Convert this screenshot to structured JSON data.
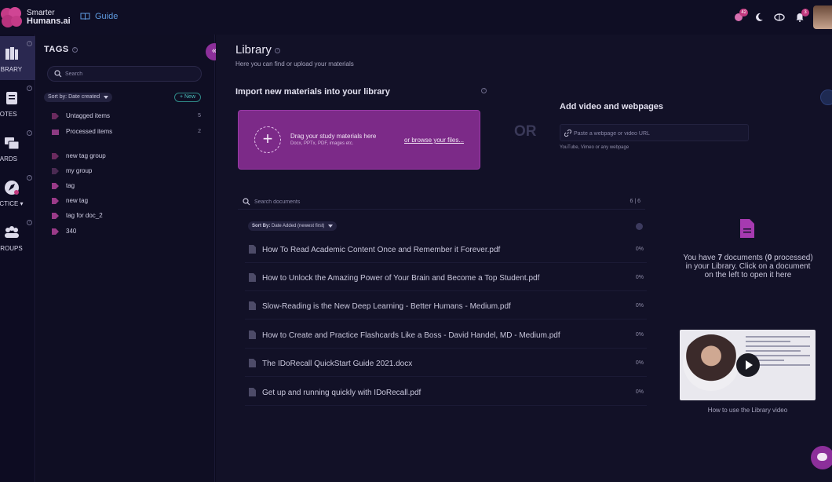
{
  "brand": {
    "line1": "Smarter",
    "line2": "Humans.ai",
    "logo_icon": "brain-logo-icon"
  },
  "header": {
    "guide_label": "Guide",
    "guide_icon": "book-open-icon",
    "icons": [
      {
        "name": "credits-icon",
        "badge": "42"
      },
      {
        "name": "moon-icon",
        "badge": ""
      },
      {
        "name": "brain-icon",
        "badge": ""
      },
      {
        "name": "bell-icon",
        "badge": "3"
      }
    ]
  },
  "rail": [
    {
      "label": "LIBRARY",
      "icon": "library-icon"
    },
    {
      "label": "NOTES",
      "icon": "notes-icon"
    },
    {
      "label": "CARDS",
      "icon": "cards-icon"
    },
    {
      "label": "ACTICE ▾",
      "icon": "rocket-icon"
    },
    {
      "label": "GROUPS",
      "icon": "groups-icon"
    }
  ],
  "tags": {
    "title": "TAGS",
    "search_placeholder": "Search",
    "sort_label": "Sort by: Date created",
    "new_label": "+ New",
    "system": [
      {
        "label": "Untagged items",
        "count": "5"
      },
      {
        "label": "Processed items",
        "count": "2"
      }
    ],
    "items": [
      "new tag group",
      "my group",
      "tag",
      "new tag",
      "tag for doc_2",
      "340"
    ]
  },
  "library": {
    "title": "Library",
    "subtitle": "Here you can find or upload your materials",
    "import_title": "Import new materials into your library",
    "drop_title": "Drag your study materials here",
    "drop_hint": "Docx, PPTx, PDF, images etc.",
    "browse_label": "or browse your files...",
    "or_label": "OR",
    "add_video_title": "Add video and webpages",
    "url_placeholder": "Paste a webpage or video URL",
    "url_hint": "YouTube, Vimeo or any webpage",
    "doc_search_placeholder": "Search documents",
    "doc_count": "6 | 6",
    "sort_prefix": "Sort By:",
    "sort_value": "Date Added (newest first)",
    "documents": [
      {
        "name": "How To Read Academic Content Once and Remember it Forever.pdf",
        "progress": "0%"
      },
      {
        "name": "How to Unlock the Amazing Power of Your Brain and Become a Top Student.pdf",
        "progress": "0%"
      },
      {
        "name": "Slow-Reading is the New Deep Learning - Better Humans - Medium.pdf",
        "progress": "0%"
      },
      {
        "name": "How to Create and Practice Flashcards Like a Boss - David Handel, MD - Medium.pdf",
        "progress": "0%"
      },
      {
        "name": "The IDoRecall QuickStart Guide 2021.docx",
        "progress": "0%"
      },
      {
        "name": " Get up and running quickly with IDoRecall.pdf",
        "progress": "0%"
      }
    ],
    "empty_prefix": "You have ",
    "empty_count": "7",
    "empty_mid": " documents (",
    "empty_processed": "0",
    "empty_suffix": " processed) in your Library. Click on a document on the left to open it here",
    "video_caption": "How to use the Library video"
  },
  "colors": {
    "accent": "#8c2f9a",
    "dropzone": "#7c2a88",
    "link": "#5f9be0",
    "teal": "#4cc1bd"
  }
}
